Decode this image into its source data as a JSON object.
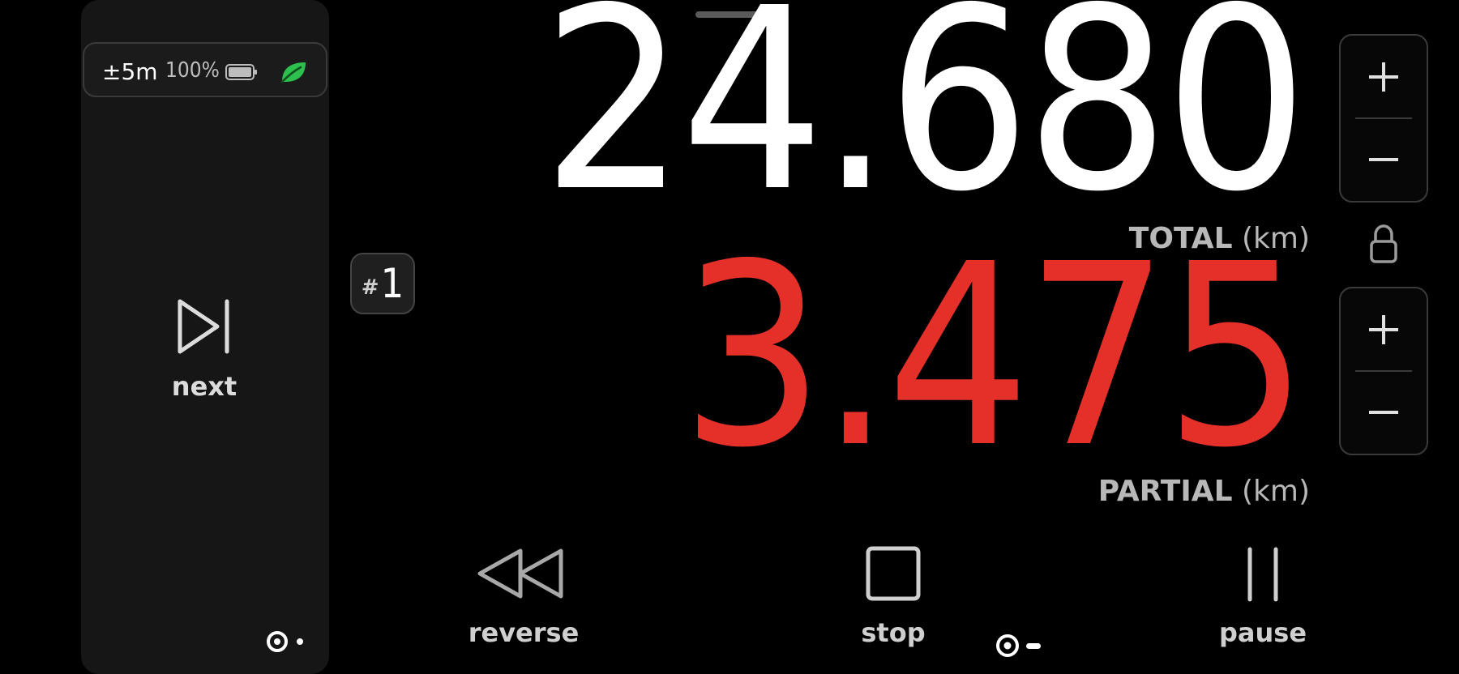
{
  "status": {
    "accuracy": "±5m",
    "battery": "100%",
    "battery_icon": "battery-full-icon",
    "eco_icon": "leaf-icon",
    "eco_color": "#2ec04f"
  },
  "left_action": {
    "label": "next",
    "icon": "skip-next-icon"
  },
  "counter": {
    "hash": "#",
    "number": "1"
  },
  "total": {
    "value": "24.680",
    "label": "TOTAL",
    "unit": "(km)",
    "color": "#ffffff"
  },
  "partial": {
    "value": "3.475",
    "label": "PARTIAL",
    "unit": "(km)",
    "color": "#e5302a"
  },
  "controls": {
    "reverse": "reverse",
    "stop": "stop",
    "pause": "pause"
  }
}
